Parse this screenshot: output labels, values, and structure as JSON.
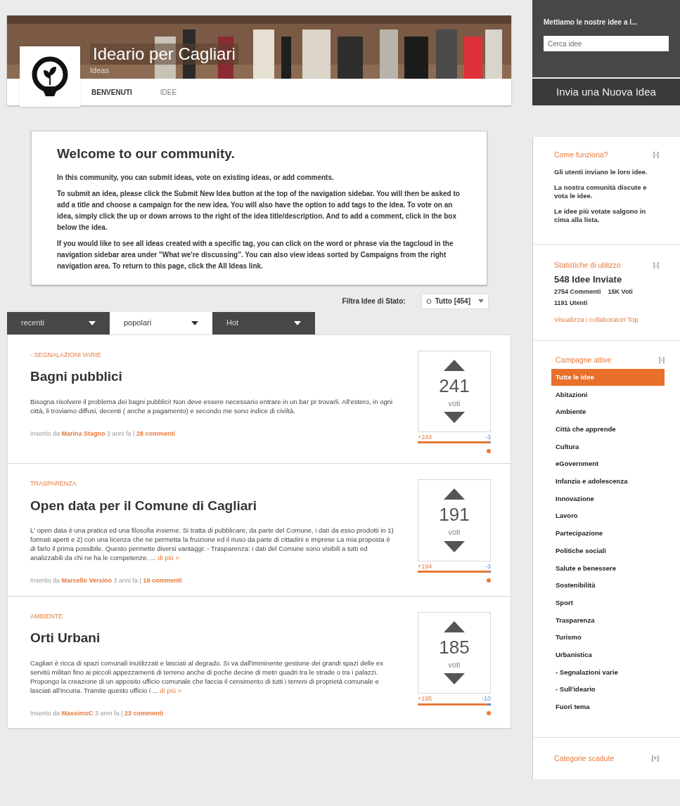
{
  "header": {
    "title": "Ideario per Cagliari",
    "subtitle": "Ideas",
    "nav": [
      {
        "label": "BENVENUTI",
        "selected": true
      },
      {
        "label": "IDEE",
        "selected": false
      }
    ]
  },
  "welcome": {
    "title": "Welcome to our community.",
    "paragraphs": [
      "In this community, you can submit ideas, vote on existing ideas, or add comments.",
      "To submit an idea, please click the Submit New Idea button at the top of the navigation sidebar. You will then be asked to add a title and choose a campaign for the new idea. You will also have the option to add tags to the idea. To vote on an idea, simply click the up or down arrows to the right of the idea title/description. And to add a comment, click in the box below the idea.",
      "If you would like to see all ideas created with a specific tag, you can click on the word or phrase via the tagcloud in the navigation sidebar area under \"What we're discussing\". You can also view ideas sorted by Campaigns from the right navigation area. To return to this page, click the All Ideas link."
    ]
  },
  "filter": {
    "label": "Filtra Idee di Stato:",
    "value": "Tutto [454]"
  },
  "tabs": [
    {
      "label": "recenti",
      "selected": false
    },
    {
      "label": "popolari",
      "selected": true
    },
    {
      "label": "Hot",
      "selected": false
    }
  ],
  "ideas": [
    {
      "category": "- SEGNALAZIONI VARIE",
      "title": "Bagni pubblici",
      "body": "Bisogna risolvere il problema dei bagni pubblici! Non deve essere necessario entrare in un bar pr trovarli. All'estero, in ogni città, li troviamo diffusi, decenti ( anche a pagamento) e secondo me sono indice di civiltà.",
      "posted_by": "Inserito da",
      "author": "Marina Stagno",
      "age": "3 anni fa |",
      "comments": "28 commenti",
      "votes": "241",
      "votes_label": "voti",
      "up": "+244",
      "down": "-3",
      "level": 0.99
    },
    {
      "category": "TRASPARENZA",
      "title": "Open data per il Comune di Cagliari",
      "body": "L' open data è una pratica ed una filosofia insieme. Si tratta di pubblicare, da parte del Comune, i dati da esso prodotti in 1) formati aperti e 2) con una licenza che ne permetta la fruizione ed il riuso da parte di cittadini e imprese La mia proposta è di farlo il prima possibile. Questo permette diversi vantaggi: - Trasparenza: i dati del Comune sono visibili a tutti ed analizzabili da chi ne ha le competenze. ...",
      "more": "di più »",
      "posted_by": "Inserito da",
      "author": "Marcello Versino",
      "age": "3 anni fa |",
      "comments": "19 commenti",
      "votes": "191",
      "votes_label": "voti",
      "up": "+194",
      "down": "-3",
      "level": 0.98
    },
    {
      "category": "AMBIENTE",
      "title": "Orti Urbani",
      "body": "Cagliari è ricca di spazi comunali inutilizzati e lasciati al degrado. Si va dall'imminente gestione dei grandi spazi delle ex servitù militari fino ai piccoli appezzamenti di terreno anche di poche decine di metri quadri tra le strade o tra i palazzi. Propongo la creazione di un apposito ufficio comunale che faccia il censimento di tutti i terreni di proprietà comunale e lasciati all'incuria. Tramite questo ufficio i ...",
      "more": "di più »",
      "posted_by": "Inserito da",
      "author": "MassimoC",
      "age": "3 anni fa |",
      "comments": "23 commenti",
      "votes": "185",
      "votes_label": "voti",
      "up": "+195",
      "down": "-10",
      "level": 0.95
    }
  ],
  "sidebar": {
    "tagline": "Mettiamo le nostre idee a l...",
    "search": {
      "placeholder": "Cerca idee"
    },
    "submit": "Invia una Nuova Idea",
    "how": {
      "title": "Come funziona?",
      "toggle": "[-]",
      "lines": [
        "Gli utenti inviano le loro idee.",
        "La nostra comunità discute e vota le idee.",
        "Le idee più votate salgono in cima alla lista."
      ]
    },
    "stats": {
      "title": "Statistiche di utilizzo",
      "toggle": "[-]",
      "ideas": "548 Idee Inviate",
      "comments": "2754 Commenti",
      "votes": "15K Voti",
      "users": "1191 Utenti",
      "link": "Visualizza i collaboratori Top"
    },
    "campaigns": {
      "title": "Campagne attive",
      "toggle": "[-]",
      "items": [
        {
          "label": "Tutte le idee",
          "selected": true
        },
        {
          "label": "Abitazioni",
          "selected": false
        },
        {
          "label": "Ambiente",
          "selected": false
        },
        {
          "label": "Città che apprende",
          "selected": false
        },
        {
          "label": "Cultura",
          "selected": false
        },
        {
          "label": "eGovernment",
          "selected": false
        },
        {
          "label": "Infanzia e adolescenza",
          "selected": false
        },
        {
          "label": "Innovazione",
          "selected": false
        },
        {
          "label": "Lavoro",
          "selected": false
        },
        {
          "label": "Partecipazione",
          "selected": false
        },
        {
          "label": "Politiche sociali",
          "selected": false
        },
        {
          "label": "Salute e benessere",
          "selected": false
        },
        {
          "label": "Sostenibilità",
          "selected": false
        },
        {
          "label": "Sport",
          "selected": false
        },
        {
          "label": "Trasparenza",
          "selected": false
        },
        {
          "label": "Turismo",
          "selected": false
        },
        {
          "label": "Urbanistica",
          "selected": false
        },
        {
          "label": "- Segnalazioni varie",
          "selected": false
        },
        {
          "label": "- Sull'ideario",
          "selected": false
        },
        {
          "label": "Fuori tema",
          "selected": false
        }
      ]
    },
    "expired": {
      "title": "Categorie scadute",
      "toggle": "[+]"
    }
  }
}
